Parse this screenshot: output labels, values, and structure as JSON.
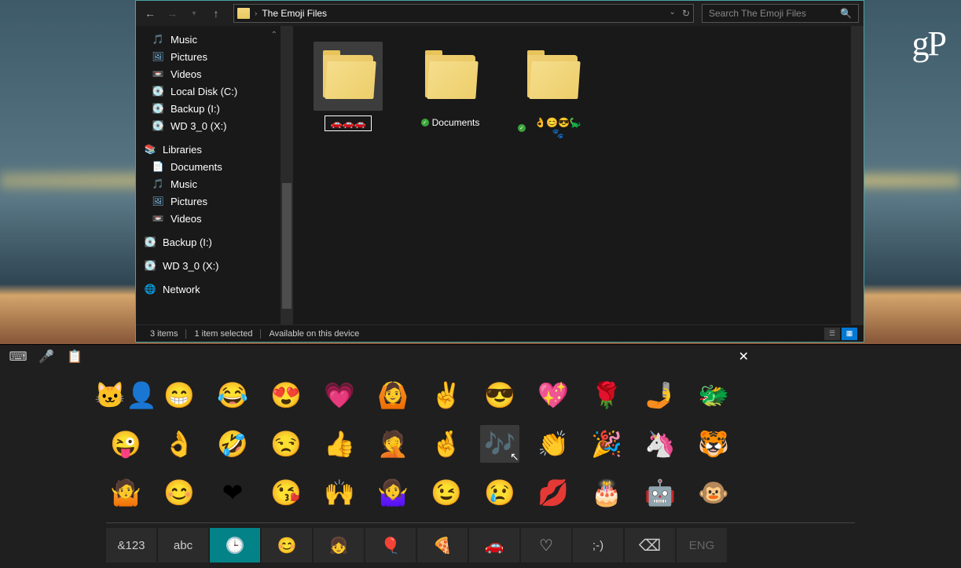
{
  "watermark": "gP",
  "toolbar": {
    "breadcrumb": "The Emoji Files",
    "refresh": "⟳"
  },
  "search": {
    "placeholder": "Search The Emoji Files"
  },
  "sidebar": {
    "items": [
      {
        "icon": "🎵",
        "label": "Music",
        "indent": 1,
        "color": "#4aa0ff"
      },
      {
        "icon": "🖼",
        "label": "Pictures",
        "indent": 1,
        "color": "#7ab8e0"
      },
      {
        "icon": "📼",
        "label": "Videos",
        "indent": 1,
        "color": "#9aa"
      },
      {
        "icon": "💽",
        "label": "Local Disk (C:)",
        "indent": 1,
        "color": "#ccc"
      },
      {
        "icon": "💽",
        "label": "Backup (I:)",
        "indent": 1,
        "color": "#ccc"
      },
      {
        "icon": "💽",
        "label": "WD 3_0 (X:)",
        "indent": 1,
        "color": "#ccc"
      },
      {
        "icon": "📚",
        "label": "Libraries",
        "indent": 0,
        "color": "#6fb8e0"
      },
      {
        "icon": "📄",
        "label": "Documents",
        "indent": 1,
        "color": "#d0a860"
      },
      {
        "icon": "🎵",
        "label": "Music",
        "indent": 1,
        "color": "#4aa0ff"
      },
      {
        "icon": "🖼",
        "label": "Pictures",
        "indent": 1,
        "color": "#7ab8e0"
      },
      {
        "icon": "📼",
        "label": "Videos",
        "indent": 1,
        "color": "#9aa"
      },
      {
        "icon": "💽",
        "label": "Backup (I:)",
        "indent": 0,
        "color": "#ccc"
      },
      {
        "icon": "💽",
        "label": "WD 3_0 (X:)",
        "indent": 0,
        "color": "#ccc"
      },
      {
        "icon": "🌐",
        "label": "Network",
        "indent": 0,
        "color": "#5b9bd5"
      }
    ]
  },
  "folders": [
    {
      "label": "🚗🚗🚗",
      "selected": true,
      "editing": true,
      "sync": false
    },
    {
      "label": "Documents",
      "selected": false,
      "editing": false,
      "sync": true
    },
    {
      "label": "👌😊😎🦕🐾",
      "selected": false,
      "editing": false,
      "sync": true
    }
  ],
  "status": {
    "count": "3 items",
    "selected": "1 item selected",
    "availability": "Available on this device"
  },
  "osk": {
    "emojis": [
      [
        "🐱‍👤",
        "😁",
        "😂",
        "😍",
        "💗",
        "🙆",
        "✌",
        "😎",
        "💖",
        "🌹",
        "🤳",
        "🐲"
      ],
      [
        "😜",
        "👌",
        "🤣",
        "😒",
        "👍",
        "🤦",
        "🤞",
        "🎶",
        "👏",
        "🎉",
        "🦄",
        "🐯"
      ],
      [
        "🤷",
        "😊",
        "❤",
        "😘",
        "🙌",
        "🤷‍♀️",
        "😉",
        "😢",
        "💋",
        "🎂",
        "🤖",
        "🐵"
      ]
    ],
    "hover_row": 1,
    "hover_col": 7,
    "tabs": [
      {
        "label": "&123",
        "type": "text"
      },
      {
        "label": "abc",
        "type": "text"
      },
      {
        "label": "🕒",
        "type": "icon",
        "active": true
      },
      {
        "label": "😊",
        "type": "icon"
      },
      {
        "label": "👧",
        "type": "icon"
      },
      {
        "label": "🎈",
        "type": "icon"
      },
      {
        "label": "🍕",
        "type": "icon"
      },
      {
        "label": "🚗",
        "type": "icon"
      },
      {
        "label": "♡",
        "type": "icon"
      },
      {
        "label": ";-)",
        "type": "text"
      },
      {
        "label": "⌫",
        "type": "icon"
      },
      {
        "label": "ENG",
        "type": "text",
        "dim": true
      }
    ]
  }
}
